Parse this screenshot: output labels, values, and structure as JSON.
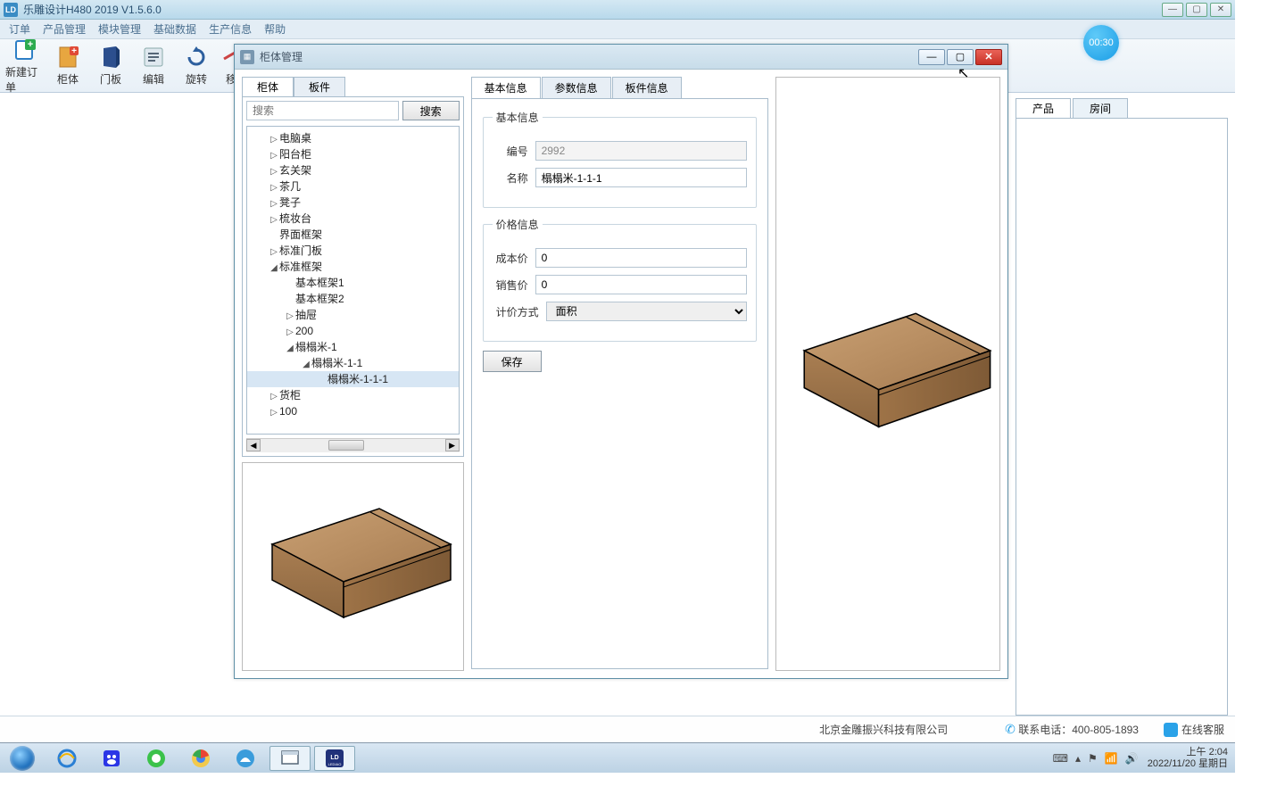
{
  "app_title": "乐雕设计H480 2019 V1.5.6.0",
  "menu": [
    "订单",
    "产品管理",
    "模块管理",
    "基础数据",
    "生产信息",
    "帮助"
  ],
  "toolbar": {
    "new_order": "新建订单",
    "cabinet": "柜体",
    "door": "门板",
    "edit": "编辑",
    "rotate": "旋转",
    "move": "移"
  },
  "right_tabs": {
    "product": "产品",
    "room": "房间"
  },
  "timer": "00:30",
  "dialog": {
    "title": "柜体管理",
    "left_tabs": {
      "cabinet": "柜体",
      "panel": "板件"
    },
    "search": {
      "placeholder": "搜索",
      "button": "搜索"
    },
    "tree": [
      {
        "indent": 1,
        "arrow": "▷",
        "label": "电脑桌"
      },
      {
        "indent": 1,
        "arrow": "▷",
        "label": "阳台柜"
      },
      {
        "indent": 1,
        "arrow": "▷",
        "label": "玄关架"
      },
      {
        "indent": 1,
        "arrow": "▷",
        "label": "茶几"
      },
      {
        "indent": 1,
        "arrow": "▷",
        "label": "凳子"
      },
      {
        "indent": 1,
        "arrow": "▷",
        "label": "梳妆台"
      },
      {
        "indent": 1,
        "arrow": "",
        "label": "界面框架"
      },
      {
        "indent": 1,
        "arrow": "▷",
        "label": "标准门板"
      },
      {
        "indent": 1,
        "arrow": "◢",
        "label": "标准框架"
      },
      {
        "indent": 2,
        "arrow": "",
        "label": "基本框架1"
      },
      {
        "indent": 2,
        "arrow": "",
        "label": "基本框架2"
      },
      {
        "indent": 2,
        "arrow": "▷",
        "label": "抽屉"
      },
      {
        "indent": 2,
        "arrow": "▷",
        "label": "200"
      },
      {
        "indent": 2,
        "arrow": "◢",
        "label": "榻榻米-1"
      },
      {
        "indent": 3,
        "arrow": "◢",
        "label": "榻榻米-1-1"
      },
      {
        "indent": 4,
        "arrow": "",
        "label": "榻榻米-1-1-1",
        "selected": true
      },
      {
        "indent": 1,
        "arrow": "▷",
        "label": "货柜"
      },
      {
        "indent": 1,
        "arrow": "▷",
        "label": "100"
      }
    ],
    "mid_tabs": {
      "basic": "基本信息",
      "params": "参数信息",
      "panels": "板件信息"
    },
    "group_basic": "基本信息",
    "field_id_label": "编号",
    "field_id_value": "2992",
    "field_name_label": "名称",
    "field_name_value": "榻榻米-1-1-1",
    "group_price": "价格信息",
    "field_cost_label": "成本价",
    "field_cost_value": "0",
    "field_sale_label": "销售价",
    "field_sale_value": "0",
    "field_method_label": "计价方式",
    "field_method_value": "面积",
    "save_button": "保存"
  },
  "footer": {
    "company": "北京金雕振兴科技有限公司",
    "phone_label": "联系电话：",
    "phone_number": "400-805-1893",
    "service": "在线客服"
  },
  "taskbar": {
    "time": "上午 2:04",
    "date": "2022/11/20 星期日"
  }
}
